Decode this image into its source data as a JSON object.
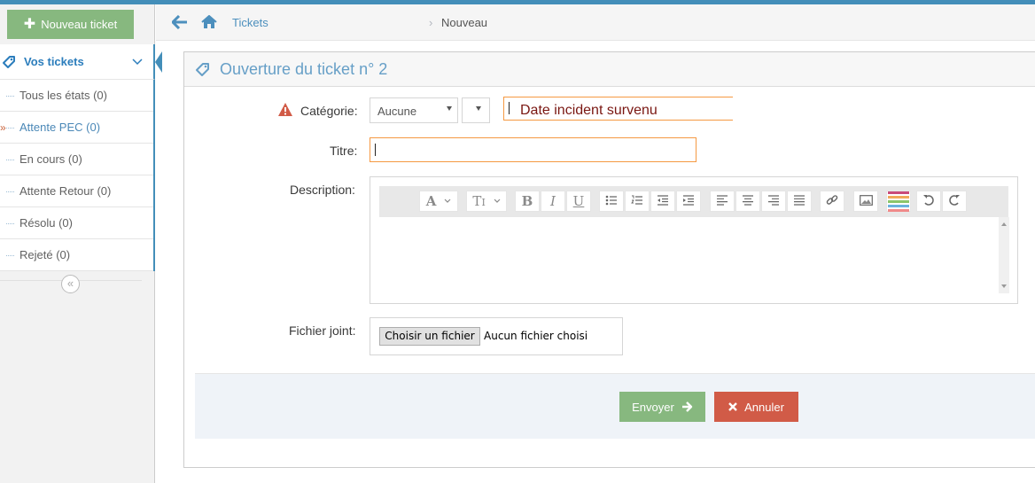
{
  "sidebar": {
    "new_ticket_label": "Nouveau ticket",
    "section_label": "Vos tickets",
    "items": [
      {
        "label": "Tous les états (0)"
      },
      {
        "label": "Attente PEC (0)"
      },
      {
        "label": "En cours (0)"
      },
      {
        "label": "Attente Retour (0)"
      },
      {
        "label": "Résolu (0)"
      },
      {
        "label": "Rejeté (0)"
      }
    ],
    "active_index": 1,
    "collapse_glyph": "«"
  },
  "breadcrumb": {
    "items": [
      "Tickets",
      "Nouveau"
    ],
    "separator": "›"
  },
  "form": {
    "title": "Ouverture du ticket n° 2",
    "categorie_label": "Catégorie:",
    "categorie_value": "Aucune",
    "date_label": "Date incident survenu",
    "titre_label": "Titre:",
    "titre_value": "",
    "description_label": "Description:",
    "fichier_label": "Fichier joint:",
    "file_button": "Choisir un fichier",
    "file_status": "Aucun fichier choisi",
    "submit_label": "Envoyer",
    "cancel_label": "Annuler"
  },
  "editor_toolbar": [
    "font-icon",
    "font-size-icon",
    "bold-icon",
    "italic-icon",
    "underline-icon",
    "bullet-list-icon",
    "numbered-list-icon",
    "outdent-icon",
    "indent-icon",
    "align-left-icon",
    "align-center-icon",
    "align-right-icon",
    "justify-icon",
    "link-icon",
    "image-icon",
    "color-icon",
    "undo-icon",
    "redo-icon"
  ],
  "colors": {
    "primary": "#438eb9",
    "success": "#87b87f",
    "danger": "#d15b47",
    "warning": "#d15b47",
    "focus": "#f59942"
  }
}
